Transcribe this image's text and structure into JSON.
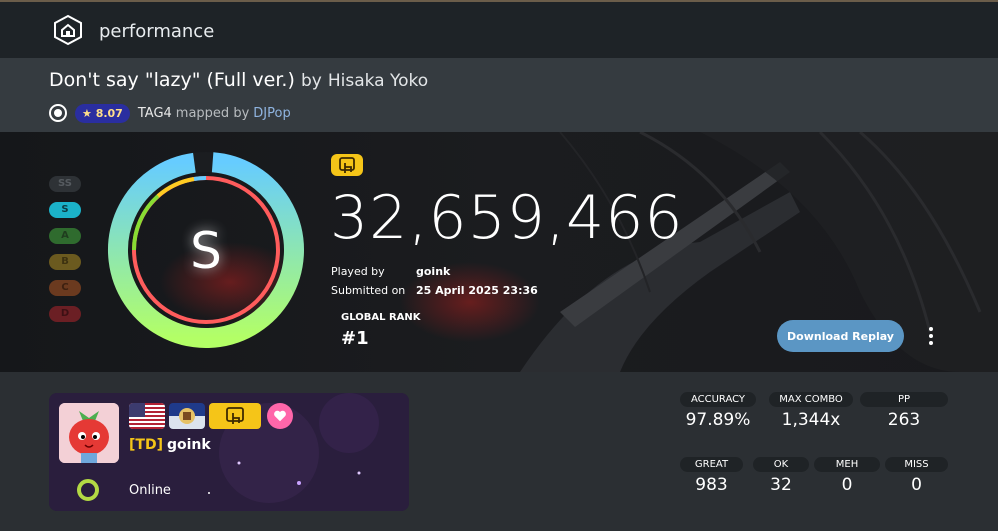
{
  "topbar": {
    "title": "performance",
    "logo_icon": "house-icon"
  },
  "beatmap": {
    "title": "Don't say \"lazy\" (Full ver.)",
    "by": "by",
    "artist": "Hisaka Yoko",
    "stars": "★ 8.07",
    "difficulty": "TAG4",
    "mapped_by": "mapped by",
    "mapper": "DJPop"
  },
  "grades": [
    {
      "label": "SS",
      "bg": "#2e3236",
      "fg": "#565b60"
    },
    {
      "label": "S",
      "bg": "#1bb2c9",
      "fg": "#0c3d45"
    },
    {
      "label": "A",
      "bg": "#2f6b2e",
      "fg": "#1f3d1e"
    },
    {
      "label": "B",
      "bg": "#6b5a1f",
      "fg": "#3d3210"
    },
    {
      "label": "C",
      "bg": "#6b3a1f",
      "fg": "#3d2010"
    },
    {
      "label": "D",
      "bg": "#6b1f24",
      "fg": "#3d1014"
    }
  ],
  "score": {
    "rank": "S",
    "total": "32,659,466",
    "accuracy_fraction": 0.9789,
    "played_by_label": "Played by",
    "played_by": "goink",
    "submitted_label": "Submitted on",
    "submitted": "25 April 2025 23:36",
    "global_rank_label": "GLOBAL RANK",
    "global_rank": "#1"
  },
  "actions": {
    "download": "Download Replay",
    "more_icon": "more-vertical-icon"
  },
  "user": {
    "team": "[TD]",
    "name": "goink",
    "status": "Online",
    "country_flag": "us-flag-icon",
    "state_flag": "state-flag-icon",
    "supporter_icon": "heart-icon"
  },
  "stats_top": [
    {
      "label": "ACCURACY",
      "value": "97.89%"
    },
    {
      "label": "MAX COMBO",
      "value": "1,344x"
    },
    {
      "label": "PP",
      "value": "263"
    }
  ],
  "stats_bottom": [
    {
      "label": "GREAT",
      "value": "983"
    },
    {
      "label": "OK",
      "value": "32"
    },
    {
      "label": "MEH",
      "value": "0"
    },
    {
      "label": "MISS",
      "value": "0"
    }
  ],
  "colors": {
    "accent": "#5b96c4",
    "ring_outer_start": "#66ccff",
    "ring_outer_end": "#b3ff66",
    "ring_inner": "#ff5c5c",
    "mods_yellow": "#f5c518"
  }
}
